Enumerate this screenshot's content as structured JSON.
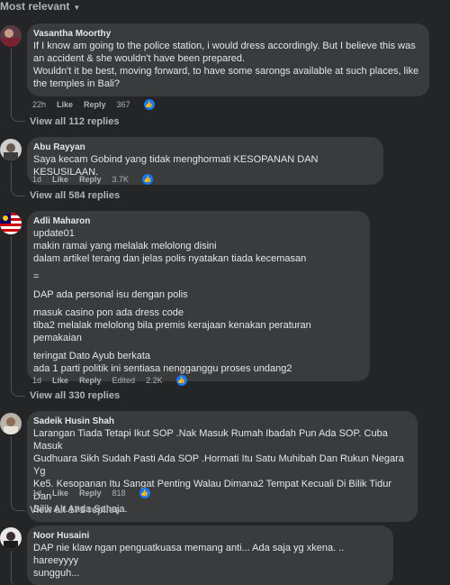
{
  "sort_label": "Most relevant",
  "comments": [
    {
      "author": "Vasantha Moorthy",
      "lines": [
        "If I know am going to the police station, i would dress accordingly. But I believe this was",
        "an accident & she wouldn't have been prepared.",
        "Wouldn't it be best, moving forward, to have some sarongs available at such places, like",
        "the temples in Bali?"
      ],
      "time": "22h",
      "like": "Like",
      "reply": "Reply",
      "reactions": "367",
      "view_replies": "View all 112 replies"
    },
    {
      "author": "Abu Rayyan",
      "lines": [
        "Saya kecam Gobind yang tidak menghormati KESOPANAN DAN KESUSILAAN."
      ],
      "time": "1d",
      "like": "Like",
      "reply": "Reply",
      "reactions": "3.7K",
      "view_replies": "View all 584 replies"
    },
    {
      "author": "Adli Maharon",
      "lines": [
        "update01",
        "makin ramai yang melalak melolong disini",
        "dalam artikel terang dan jelas polis nyatakan tiada kecemasan",
        "=",
        "DAP ada personal isu dengan polis",
        "masuk casino pon ada dress code",
        "tiba2 melalak melolong bila premis kerajaan kenakan peraturan pemakaian",
        "teringat Dato Ayub berkata",
        "ada 1 parti politik ini sentiasa nengganggu proses undang2"
      ],
      "time": "1d",
      "like": "Like",
      "reply": "Reply",
      "edited": "Edited",
      "reactions": "2.2K",
      "view_replies": "View all 330 replies"
    },
    {
      "author": "Sadeik Husin Shah",
      "lines": [
        "Larangan Tiada Tetapi Ikut SOP .Nak Masuk Rumah Ibadah Pun Ada SOP. Cuba Masuk",
        "Gudhuara Sikh Sudah Pasti Ada SOP .Hormati Itu Satu Muhibah Dan Rukun Negara Yg",
        "Ke5. Kesopanan Itu Sangat Penting Walau Dimana2 Tempat Kecuali Di Bilik Tidur Dan",
        "Bilik Air.Anda Sahaja."
      ],
      "time": "1d",
      "like": "Like",
      "reply": "Reply",
      "reactions": "818",
      "view_replies": "View all 171 replies"
    },
    {
      "author": "Noor Husaini",
      "lines": [
        "DAP nie klaw ngan penguatkuasa memang anti... Ada saja yg xkena. .. hareeyyyy",
        "sungguh..."
      ]
    }
  ],
  "colors": {
    "background": "#242526",
    "bubble": "#3a3b3c",
    "like_blue": "#1877f2",
    "text": "#e4e6eb",
    "muted": "#b0b3b8"
  },
  "icons": {
    "sort": "caret-down-icon",
    "reaction": "thumbs-up-icon"
  }
}
